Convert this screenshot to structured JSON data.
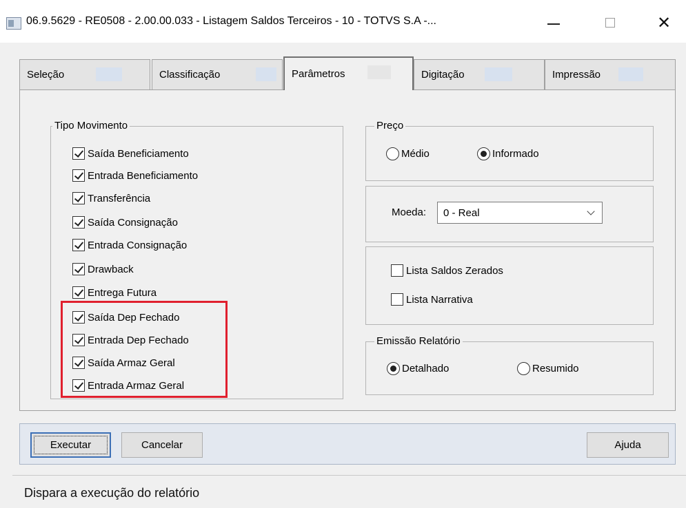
{
  "window": {
    "title": "06.9.5629 - RE0508 - 2.00.00.033 - Listagem Saldos Terceiros - 10 - TOTVS S.A -...",
    "minimize_glyph": "",
    "close_glyph": "✕"
  },
  "tabs": [
    {
      "label": "Seleção",
      "active": false
    },
    {
      "label": "Classificação",
      "active": false
    },
    {
      "label": "Parâmetros",
      "active": true
    },
    {
      "label": "Digitação",
      "active": false
    },
    {
      "label": "Impressão",
      "active": false
    }
  ],
  "tipo_movimento": {
    "title": "Tipo Movimento",
    "items": [
      {
        "label": "Saída Beneficiamento",
        "checked": true
      },
      {
        "label": "Entrada Beneficiamento",
        "checked": true
      },
      {
        "label": "Transferência",
        "checked": true
      },
      {
        "label": "Saída Consignação",
        "checked": true
      },
      {
        "label": "Entrada Consignação",
        "checked": true
      },
      {
        "label": "Drawback",
        "checked": true
      },
      {
        "label": "Entrega Futura",
        "checked": true
      },
      {
        "label": "Saída Dep Fechado",
        "checked": true
      },
      {
        "label": "Entrada Dep Fechado",
        "checked": true
      },
      {
        "label": "Saída Armaz Geral",
        "checked": true
      },
      {
        "label": "Entrada Armaz Geral",
        "checked": true
      }
    ]
  },
  "preco": {
    "title": "Preço",
    "options": [
      {
        "label": "Médio",
        "selected": false
      },
      {
        "label": "Informado",
        "selected": true
      }
    ]
  },
  "moeda": {
    "label": "Moeda:",
    "value": "0 - Real"
  },
  "lista": {
    "items": [
      {
        "label": "Lista Saldos Zerados",
        "checked": false
      },
      {
        "label": "Lista Narrativa",
        "checked": false
      }
    ]
  },
  "emissao": {
    "title": "Emissão Relatório",
    "options": [
      {
        "label": "Detalhado",
        "selected": true
      },
      {
        "label": "Resumido",
        "selected": false
      }
    ]
  },
  "buttons": {
    "executar": "Executar",
    "cancelar": "Cancelar",
    "ajuda": "Ajuda"
  },
  "status": {
    "text": "Dispara a execução do relatório"
  },
  "colors": {
    "highlight": "#e0202e",
    "button_bar": "#e3e8f0",
    "default_button_border": "#3c6fb6"
  }
}
